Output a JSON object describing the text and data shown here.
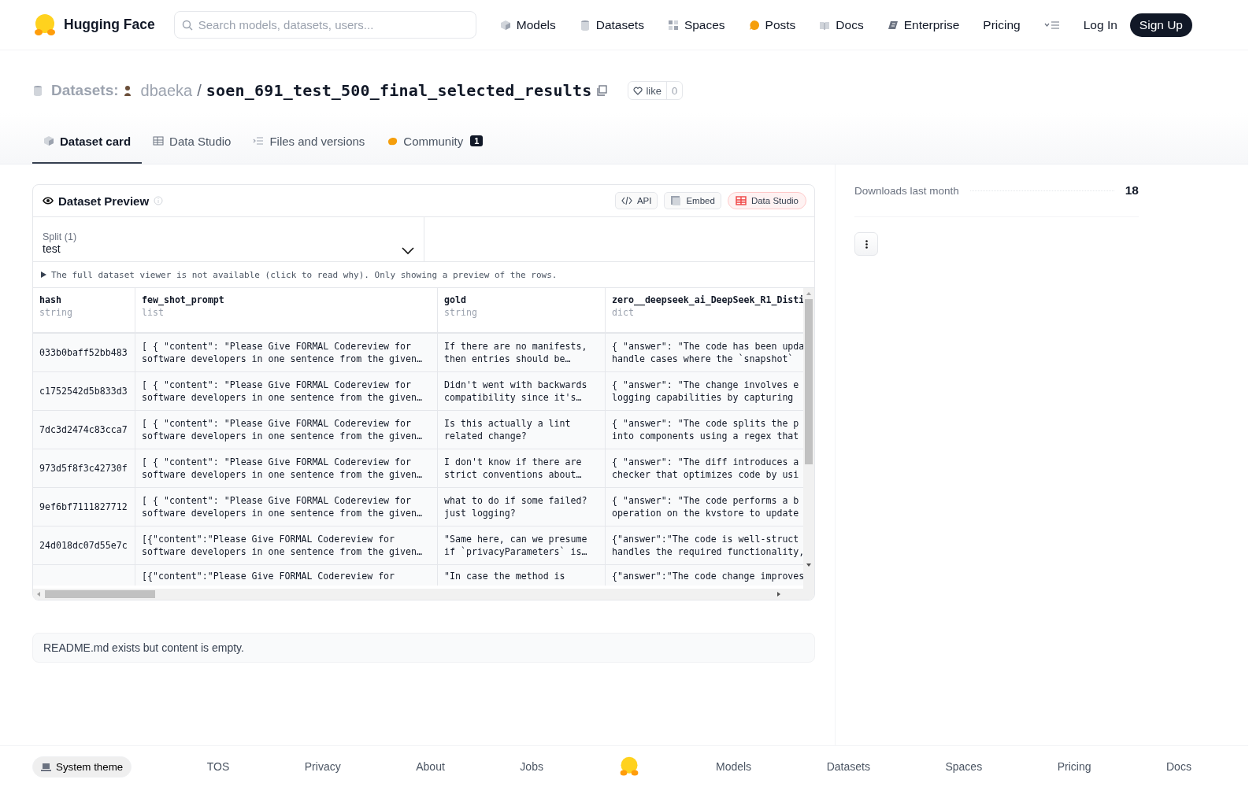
{
  "nav": {
    "brand": "Hugging Face",
    "search": {
      "placeholder": "Search models, datasets, users..."
    },
    "links": [
      {
        "kind": "models",
        "label": "Models"
      },
      {
        "kind": "datasets",
        "label": "Datasets"
      },
      {
        "kind": "spaces",
        "label": "Spaces"
      },
      {
        "kind": "posts",
        "label": "Posts"
      },
      {
        "kind": "docs",
        "label": "Docs"
      },
      {
        "kind": "enterprise",
        "label": "Enterprise"
      },
      {
        "kind": "pricing",
        "label": "Pricing"
      }
    ],
    "login": "Log In",
    "signup": "Sign Up"
  },
  "repo": {
    "section": "Datasets:",
    "owner": "dbaeka",
    "separator": "/",
    "name": "soen_691_test_500_final_selected_results",
    "like": "like",
    "likes": "0"
  },
  "tabs": [
    {
      "kind": "card",
      "label": "Dataset card",
      "selected": true
    },
    {
      "kind": "studio",
      "label": "Data Studio",
      "selected": false
    },
    {
      "kind": "files",
      "label": "Files and versions",
      "selected": false
    },
    {
      "kind": "community",
      "label": "Community",
      "badge": "1",
      "selected": false
    }
  ],
  "preview": {
    "title": "Dataset Preview",
    "actions": [
      {
        "kind": "api",
        "label": "API"
      },
      {
        "kind": "embed",
        "label": "Embed"
      },
      {
        "kind": "studio",
        "label": "Data Studio"
      }
    ],
    "split": {
      "label": "Split (1)",
      "value": "test"
    },
    "notice": "The full dataset viewer is not available (click to read why). Only showing a preview of the rows.",
    "table": {
      "columns": [
        {
          "name": "hash",
          "type": "string"
        },
        {
          "name": "few_shot_prompt",
          "type": "list"
        },
        {
          "name": "gold",
          "type": "string"
        },
        {
          "name": "zero__deepseek_ai_DeepSeek_R1_Disti",
          "type": "dict"
        }
      ],
      "rows": [
        {
          "cells": [
            "033b0baff52bb483",
            "[ { \"content\": \"Please Give FORMAL Codereview for\nsoftware developers in one sentence from the given…",
            "If there are no manifests,\nthen entries should be…",
            "{ \"answer\": \"The code has been upda\nhandle cases where the `snapshot`"
          ]
        },
        {
          "cells": [
            "c1752542d5b833d3",
            "[ { \"content\": \"Please Give FORMAL Codereview for\nsoftware developers in one sentence from the given…",
            "Didn't went with backwards\ncompatibility since it's…",
            "{ \"answer\": \"The change involves e\nlogging capabilities by capturing"
          ]
        },
        {
          "cells": [
            "7dc3d2474c83cca7",
            "[ { \"content\": \"Please Give FORMAL Codereview for\nsoftware developers in one sentence from the given…",
            "Is this actually a lint\nrelated change?",
            "{ \"answer\": \"The code splits the p\ninto components using a regex that"
          ]
        },
        {
          "cells": [
            "973d5f8f3c42730f",
            "[ { \"content\": \"Please Give FORMAL Codereview for\nsoftware developers in one sentence from the given…",
            "I don't know if there are\nstrict conventions about…",
            "{ \"answer\": \"The diff introduces a\nchecker that optimizes code by usi"
          ]
        },
        {
          "cells": [
            "9ef6bf7111827712",
            "[ { \"content\": \"Please Give FORMAL Codereview for\nsoftware developers in one sentence from the given…",
            "what to do if some failed?\njust logging?",
            "{ \"answer\": \"The code performs a b\noperation on the kvstore to update"
          ]
        },
        {
          "cells": [
            "24d018dc07d55e7c",
            "[{\"content\":\"Please Give FORMAL Codereview for\nsoftware developers in one sentence from the given…",
            "\"Same here, can we presume\nif `privacyParameters` is…",
            "{\"answer\":\"The code is well-struct\nhandles the required functionality,"
          ]
        },
        {
          "partial": true,
          "cells": [
            null,
            "[{\"content\":\"Please Give FORMAL Codereview for",
            "\"In case the method is",
            "{\"answer\":\"The code change improves"
          ]
        }
      ]
    }
  },
  "readme": "README.md exists but content is empty.",
  "sidebar": {
    "downloads_label": "Downloads last month",
    "downloads": "18"
  },
  "footer": {
    "theme": "System theme",
    "links_left": [
      "TOS",
      "Privacy",
      "About",
      "Jobs"
    ],
    "links_right": [
      "Models",
      "Datasets",
      "Spaces",
      "Pricing",
      "Docs"
    ]
  }
}
